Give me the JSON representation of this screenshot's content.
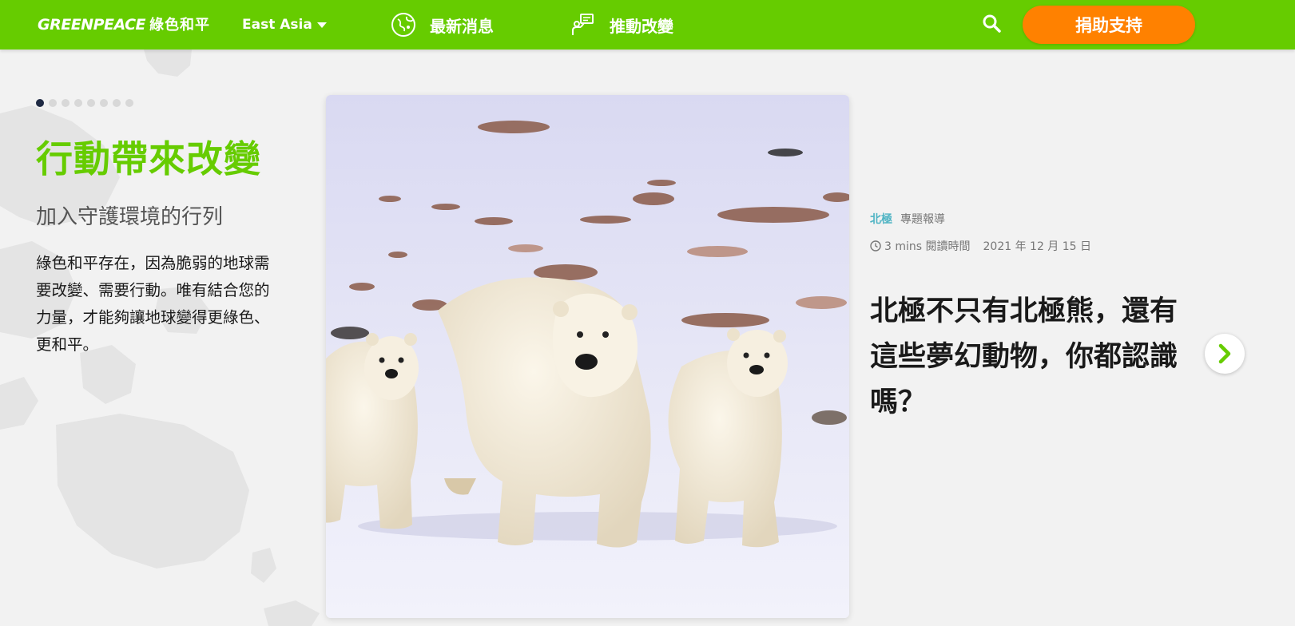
{
  "header": {
    "logo_text": "GREENPEACE",
    "logo_cn": "綠色和平",
    "region_label": "East Asia",
    "nav": [
      {
        "label": "最新消息",
        "icon": "globe-icon"
      },
      {
        "label": "推動改變",
        "icon": "megaphone-icon"
      }
    ],
    "search_icon": "search-icon",
    "donate_label": "捐助支持"
  },
  "colors": {
    "brand_green": "#66cc00",
    "donate_orange": "#ff8100",
    "tag_teal": "#4fb4c4",
    "dot_active": "#1f2a44"
  },
  "carousel": {
    "slide_count": 8,
    "active_index": 0
  },
  "hero": {
    "title": "行動帶來改變",
    "subtitle": "加入守護環境的行列",
    "body": "綠色和平存在，因為脆弱的地球需要改變、需要行動。唯有結合您的力量，才能夠讓地球變得更綠色、更和平。"
  },
  "article": {
    "tag_primary": "北極",
    "tag_secondary": "專題報導",
    "read_time": "3 mins 閱讀時間",
    "date": "2021 年 12 月 15 日",
    "title": "北極不只有北極熊，還有這些夢幻動物，你都認識嗎？"
  },
  "next_icon": "chevron-right-icon"
}
